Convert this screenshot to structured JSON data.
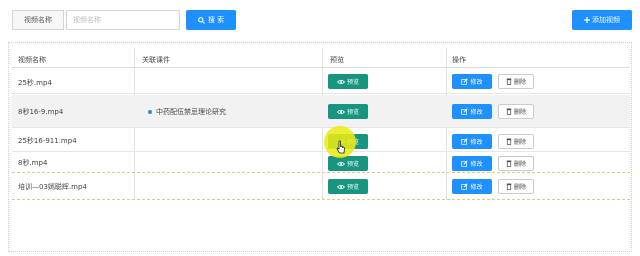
{
  "search": {
    "label": "视频名称",
    "placeholder": "视频名称",
    "button_label": "搜 索",
    "button_icon": "search-icon"
  },
  "toolbar": {
    "add_label": "添加视频",
    "add_icon": "plus-icon"
  },
  "table": {
    "headers": [
      "视频名称",
      "关联课件",
      "预览",
      "操作"
    ],
    "preview_label": "预览",
    "edit_label": "修改",
    "delete_label": "删除",
    "rows": [
      {
        "name": "25秒.mp4",
        "course": ""
      },
      {
        "name": "8秒16-9.mp4",
        "course": "中药配伍禁忌理论研究"
      },
      {
        "name": "25秒16-911.mp4",
        "course": ""
      },
      {
        "name": "8秒.mp4",
        "course": ""
      },
      {
        "name": "培训—03嫣聪辉.mp4",
        "course": ""
      }
    ]
  },
  "colors": {
    "primary": "#1e90ff",
    "preview": "#17957f",
    "cursor_highlight": "#ebeb14",
    "course_dot": "#2b8fd6"
  }
}
